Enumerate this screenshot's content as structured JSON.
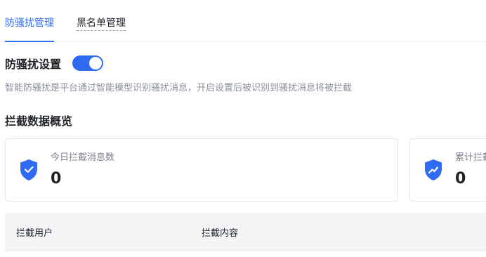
{
  "tabs": [
    {
      "label": "防骚扰管理",
      "active": true
    },
    {
      "label": "黑名单管理",
      "active": false
    }
  ],
  "setting": {
    "title": "防骚扰设置",
    "toggle_on": true,
    "description": "智能防骚扰是平台通过智能模型识别骚扰消息，开启设置后被识别到骚扰消息将被拦截"
  },
  "overview": {
    "title": "拦截数据概览",
    "cards": [
      {
        "label": "今日拦截消息数",
        "value": "0",
        "icon": "shield-check-icon"
      },
      {
        "label": "累计拦截消息数",
        "value": "0",
        "icon": "shield-trend-icon"
      }
    ]
  },
  "table": {
    "columns": [
      "拦截用户",
      "拦截内容"
    ]
  },
  "colors": {
    "accent": "#2f6bf2",
    "muted_text": "#8a8f99",
    "header_bg": "#f4f5f7"
  }
}
